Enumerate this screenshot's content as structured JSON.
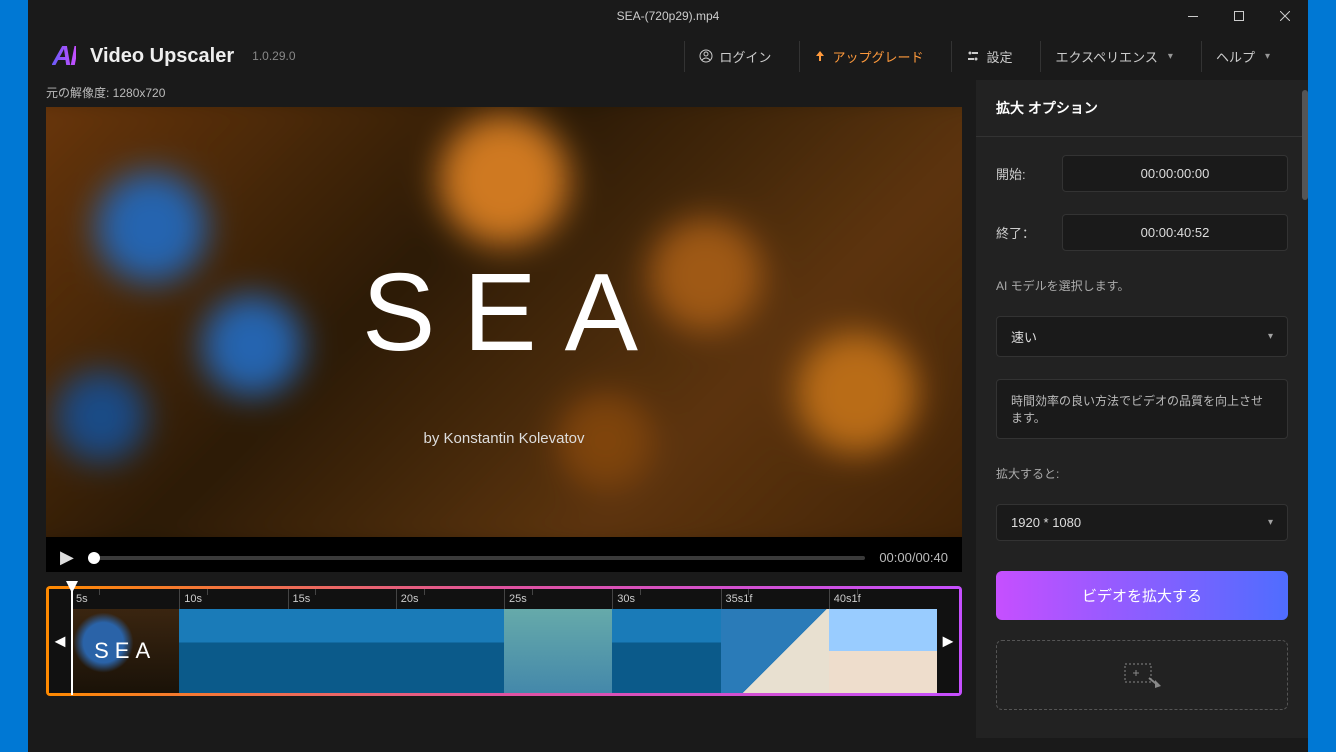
{
  "titlebar": {
    "filename": "SEA-(720p29).mp4"
  },
  "header": {
    "app_name": "Video Upscaler",
    "version": "1.0.29.0",
    "login": "ログイン",
    "upgrade": "アップグレード",
    "settings": "設定",
    "experience": "エクスペリエンス",
    "help": "ヘルプ"
  },
  "preview": {
    "meta": "元の解像度: 1280x720",
    "overlay_title": "SEA",
    "overlay_subtitle": "by Konstantin Kolevatov",
    "time_display": "00:00/00:40"
  },
  "timeline": {
    "marks": [
      "5s",
      "10s",
      "15s",
      "20s",
      "25s",
      "30s",
      "35s1f",
      "40s1f"
    ]
  },
  "panel": {
    "title": "拡大 オプション",
    "start_label": "開始:",
    "start_value": "00:00:00:00",
    "end_label": "終了：",
    "end_value": "00:00:40:52",
    "model_section": "AI モデルを選択します。",
    "model_selected": "速い",
    "model_desc": "時間効率の良い方法でビデオの品質を向上させます。",
    "upscale_to_label": "拡大すると:",
    "resolution_selected": "1920 * 1080",
    "primary_button": "ビデオを拡大する"
  }
}
